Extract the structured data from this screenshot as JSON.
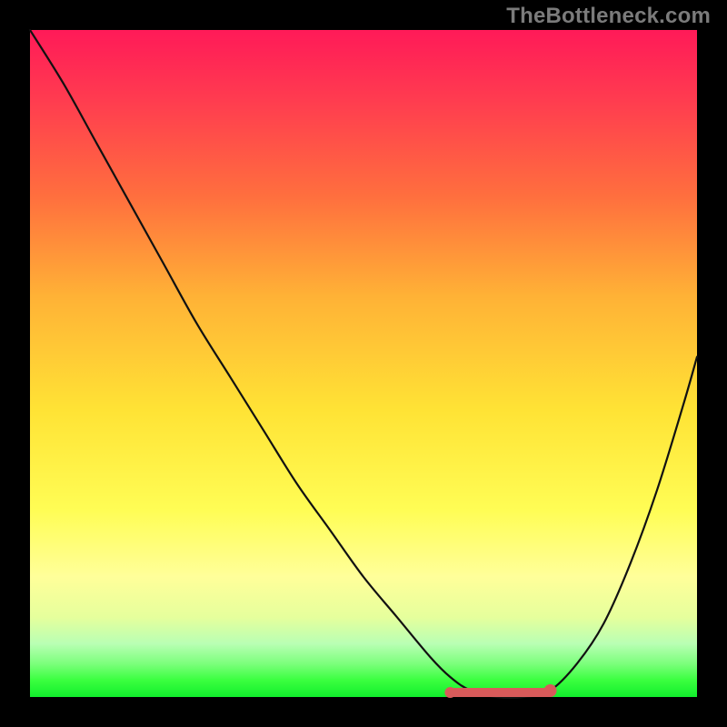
{
  "watermark": "TheBottleneck.com",
  "chart_data": {
    "type": "line",
    "title": "",
    "xlabel": "",
    "ylabel": "",
    "xlim": [
      0,
      100
    ],
    "ylim": [
      0,
      100
    ],
    "series": [
      {
        "name": "bottleneck-curve",
        "x": [
          0,
          5,
          10,
          15,
          20,
          25,
          30,
          35,
          40,
          45,
          50,
          55,
          60,
          63,
          66,
          70,
          74,
          78,
          82,
          86,
          90,
          94,
          98,
          100
        ],
        "values": [
          100,
          92,
          83,
          74,
          65,
          56,
          48,
          40,
          32,
          25,
          18,
          12,
          6,
          3,
          1,
          0,
          0,
          1,
          5,
          11,
          20,
          31,
          44,
          51
        ]
      }
    ],
    "highlight": {
      "name": "optimal-range",
      "x_start": 63,
      "x_end": 78,
      "y": 0
    },
    "gradient_meaning": "background encodes bottleneck severity: red=high, green=low"
  }
}
